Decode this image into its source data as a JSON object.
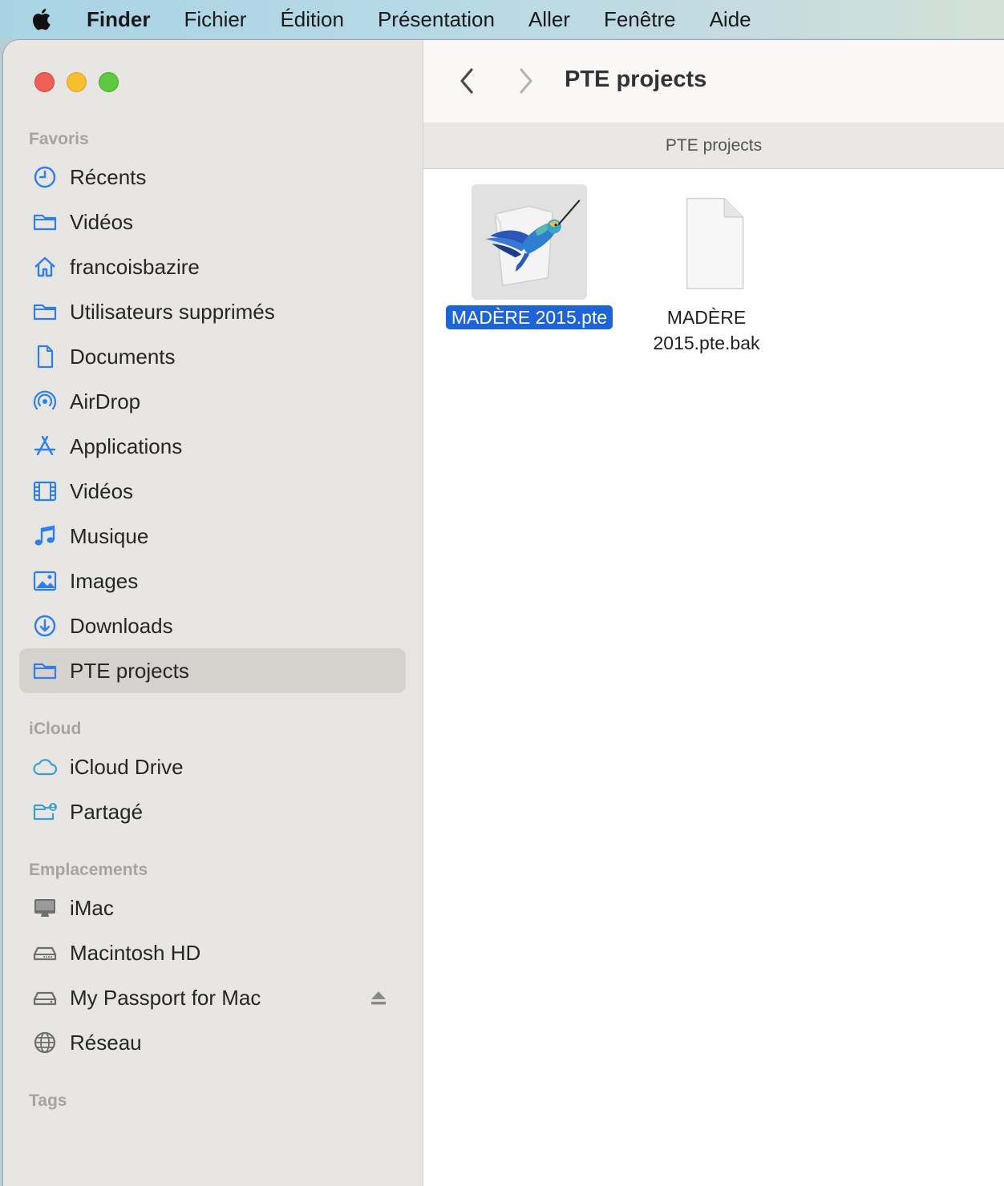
{
  "menubar": {
    "app": "Finder",
    "items": [
      "Fichier",
      "Édition",
      "Présentation",
      "Aller",
      "Fenêtre",
      "Aide"
    ]
  },
  "sidebar": {
    "favorites_title": "Favoris",
    "favorites": [
      {
        "label": "Récents",
        "icon": "clock-icon"
      },
      {
        "label": "Vidéos",
        "icon": "folder-icon"
      },
      {
        "label": "francoisbazire",
        "icon": "home-icon"
      },
      {
        "label": "Utilisateurs supprimés",
        "icon": "folder-icon"
      },
      {
        "label": "Documents",
        "icon": "document-icon"
      },
      {
        "label": "AirDrop",
        "icon": "airdrop-icon"
      },
      {
        "label": "Applications",
        "icon": "applications-icon"
      },
      {
        "label": "Vidéos",
        "icon": "film-icon"
      },
      {
        "label": "Musique",
        "icon": "music-note-icon"
      },
      {
        "label": "Images",
        "icon": "photo-icon"
      },
      {
        "label": "Downloads",
        "icon": "download-icon"
      },
      {
        "label": "PTE projects",
        "icon": "folder-icon",
        "selected": true
      }
    ],
    "icloud_title": "iCloud",
    "icloud": [
      {
        "label": "iCloud Drive",
        "icon": "cloud-icon"
      },
      {
        "label": "Partagé",
        "icon": "shared-folder-icon"
      }
    ],
    "locations_title": "Emplacements",
    "locations": [
      {
        "label": "iMac",
        "icon": "imac-icon"
      },
      {
        "label": "Macintosh HD",
        "icon": "hard-drive-icon"
      },
      {
        "label": "My Passport for Mac",
        "icon": "external-drive-icon",
        "ejectable": true
      },
      {
        "label": "Réseau",
        "icon": "network-globe-icon"
      }
    ],
    "tags_title": "Tags"
  },
  "toolbar": {
    "title": "PTE projects"
  },
  "pathbar": {
    "label": "PTE projects"
  },
  "files": [
    {
      "name": "MADÈRE 2015.pte",
      "icon": "pte-hummingbird-icon",
      "selected": true
    },
    {
      "name_line1": "MADÈRE",
      "name_line2": "2015.pte.bak",
      "icon": "blank-document-icon",
      "selected": false
    }
  ],
  "colors": {
    "accent": "#1c64d8",
    "sidebar_icon": "#2d7ff0",
    "close": "#ee5f58",
    "minimize": "#f7bf2e",
    "zoom": "#5ec840"
  }
}
